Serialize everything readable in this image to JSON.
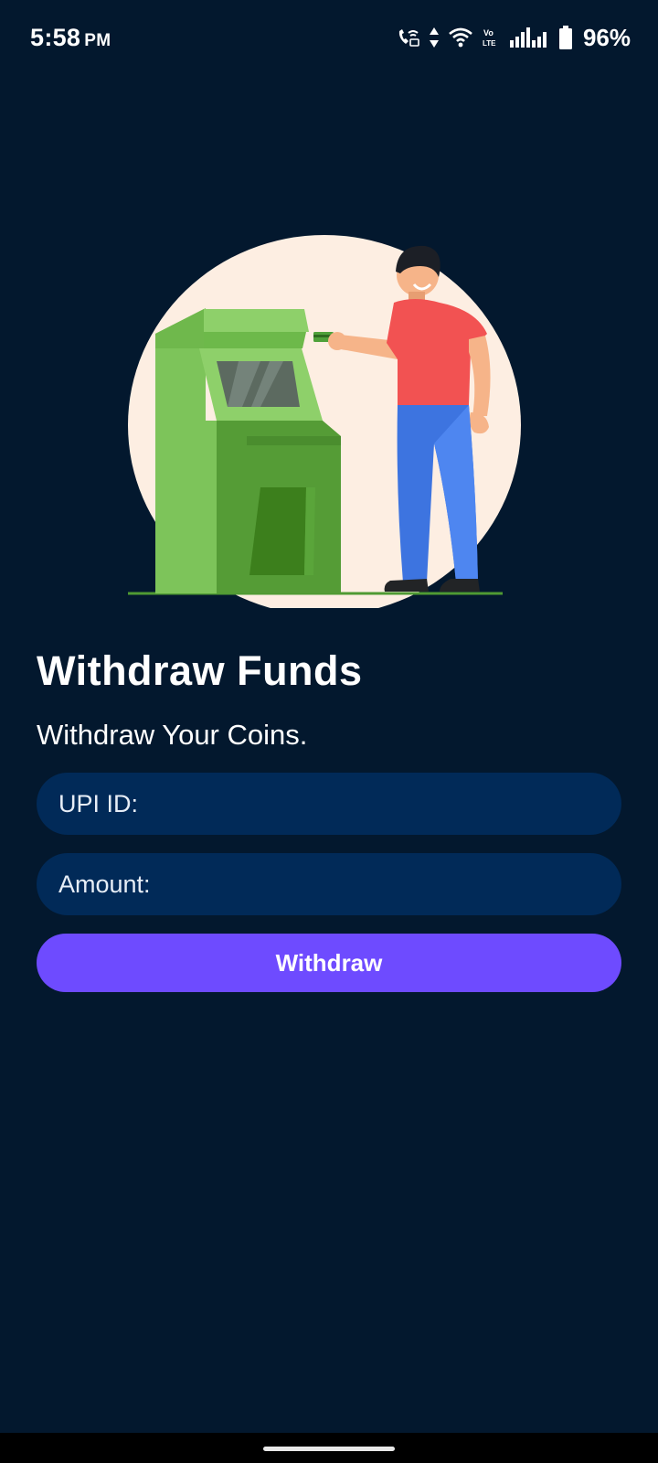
{
  "status_bar": {
    "time": "5:58",
    "ampm": "PM",
    "battery": "96%",
    "icons": [
      "wifi-calling-icon",
      "data-arrows-icon",
      "wifi-icon",
      "volte-icon",
      "signal-icon",
      "signal-icon",
      "battery-icon"
    ]
  },
  "illustration": {
    "description_icon": "atm-withdraw-illustration",
    "colors": {
      "circle": "#fdeee2",
      "atm_light": "#7dc45a",
      "atm_dark": "#559c36",
      "shirt": "#f25252",
      "pants": "#3d74e0"
    }
  },
  "page": {
    "title": "Withdraw Funds",
    "subtitle": "Withdraw Your Coins."
  },
  "form": {
    "upi_placeholder": "UPI ID:",
    "upi_value": "",
    "amount_placeholder": "Amount:",
    "amount_value": "",
    "submit_label": "Withdraw"
  },
  "colors": {
    "background": "#03182e",
    "input_bg": "#012a58",
    "button_bg": "#6e4bff",
    "text": "#ffffff"
  }
}
